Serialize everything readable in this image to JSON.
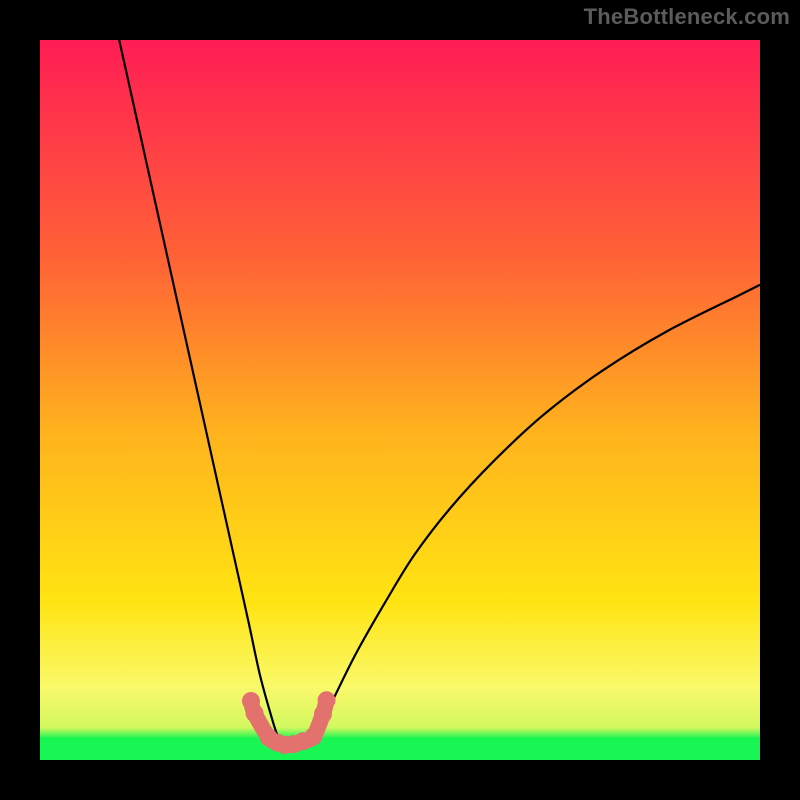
{
  "attribution": "TheBottleneck.com",
  "colors": {
    "frame": "#000000",
    "curve_stroke": "#000000",
    "marker_fill": "#e3716e",
    "green_band": "#17f653",
    "green_fade_top": "#d2f85f",
    "gradient_top": "#ff1d55",
    "gradient_mid_a": "#ff6136",
    "gradient_mid_b": "#ffb41d",
    "gradient_mid_c": "#ffe412",
    "gradient_bottom_transition": "#f9f96a"
  },
  "chart_data": {
    "type": "line",
    "title": "",
    "xlabel": "",
    "ylabel": "",
    "xlim": [
      0,
      100
    ],
    "ylim": [
      0,
      100
    ],
    "series": [
      {
        "name": "bottleneck-curve",
        "x": [
          11,
          13,
          15,
          17,
          19,
          21,
          23,
          25,
          27,
          29,
          30.5,
          32,
          33,
          34,
          34.7,
          36,
          37.5,
          39,
          41,
          44,
          48,
          52,
          57,
          63,
          70,
          78,
          87,
          97,
          100
        ],
        "y": [
          100,
          91,
          82,
          73,
          64,
          55,
          46,
          37,
          28,
          19,
          12,
          6.5,
          3.4,
          2.2,
          2.0,
          2.2,
          3.0,
          5.0,
          9.0,
          15,
          22,
          28.5,
          35,
          41.5,
          48,
          54,
          59.5,
          64.5,
          66
        ]
      }
    ],
    "markers": [
      {
        "x": 29.3,
        "y": 8.2
      },
      {
        "x": 29.8,
        "y": 6.5
      },
      {
        "x": 31.8,
        "y": 3.1
      },
      {
        "x": 33.0,
        "y": 2.4
      },
      {
        "x": 34.0,
        "y": 2.1
      },
      {
        "x": 35.2,
        "y": 2.2
      },
      {
        "x": 36.5,
        "y": 2.6
      },
      {
        "x": 38.0,
        "y": 3.3
      },
      {
        "x": 39.3,
        "y": 6.4
      },
      {
        "x": 39.8,
        "y": 8.3
      }
    ],
    "background_bands": {
      "gradient": [
        {
          "stop": 0.0,
          "color": "#ff1d55"
        },
        {
          "stop": 0.3,
          "color": "#ff6136"
        },
        {
          "stop": 0.55,
          "color": "#ffb41d"
        },
        {
          "stop": 0.78,
          "color": "#ffe412"
        },
        {
          "stop": 0.9,
          "color": "#f9f96a"
        },
        {
          "stop": 0.955,
          "color": "#d2f85f"
        },
        {
          "stop": 0.97,
          "color": "#17f653"
        },
        {
          "stop": 1.0,
          "color": "#17f653"
        }
      ]
    }
  }
}
